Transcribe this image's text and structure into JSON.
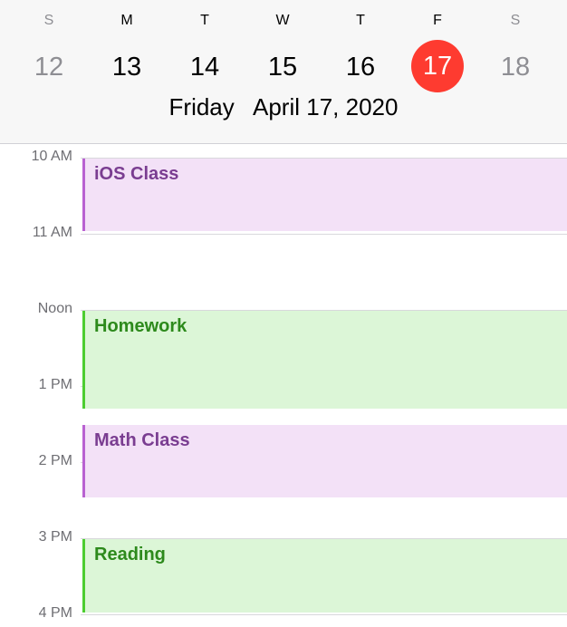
{
  "week": {
    "weekdays": [
      "S",
      "M",
      "T",
      "W",
      "T",
      "F",
      "S"
    ],
    "days": [
      "12",
      "13",
      "14",
      "15",
      "16",
      "17",
      "18"
    ],
    "selected_index": 5
  },
  "date_title": "Friday   April 17, 2020",
  "timeline": {
    "hour_labels": [
      "10 AM",
      "11 AM",
      "Noon",
      "1 PM",
      "2 PM",
      "3 PM",
      "4 PM"
    ]
  },
  "events": [
    {
      "title": "iOS Class",
      "color": "purple",
      "start": "10:00 AM",
      "end": "11:00 AM"
    },
    {
      "title": "Homework",
      "color": "green",
      "start": "12:00 PM",
      "end": "1:15 PM"
    },
    {
      "title": "Math Class",
      "color": "purple",
      "start": "1:30 PM",
      "end": "2:30 PM"
    },
    {
      "title": "Reading",
      "color": "green",
      "start": "3:00 PM",
      "end": "4:00 PM"
    }
  ],
  "colors": {
    "today_circle": "#fe3b30",
    "purple_bar": "#b961d1",
    "green_bar": "#4ccd30"
  }
}
